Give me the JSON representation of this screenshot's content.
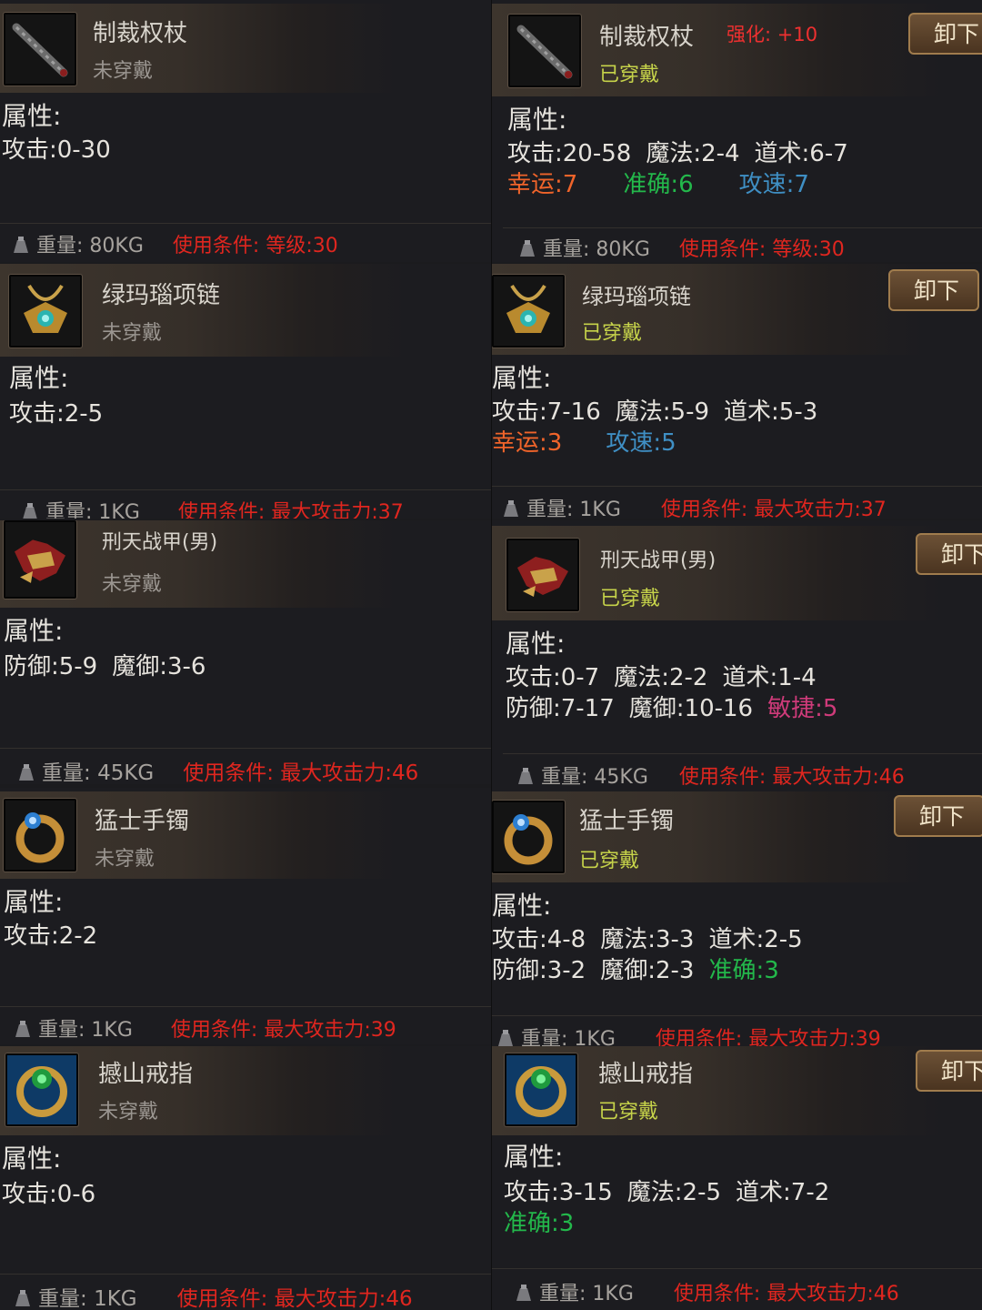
{
  "labels": {
    "attributes": "属性:",
    "weight": "重量:",
    "requirement": "使用条件:",
    "unequip": "卸下",
    "enhance": "强化: +10"
  },
  "items": [
    {
      "left": {
        "name": "制裁权杖",
        "state": "未穿戴",
        "icon": "scepter-icon",
        "lines": [
          [
            {
              "t": "攻击:0-30",
              "c": "white"
            }
          ]
        ],
        "weight": "80KG",
        "requirement": "等级:30"
      },
      "right": {
        "name": "制裁权杖",
        "state": "已穿戴",
        "icon": "scepter-icon",
        "lines": [
          [
            {
              "t": "攻击:20-58",
              "c": "white"
            },
            {
              "t": "魔法:2-4",
              "c": "white"
            },
            {
              "t": "道术:6-7",
              "c": "white"
            }
          ],
          [
            {
              "t": "幸运:7",
              "c": "orange"
            },
            {
              "t": "准确:6",
              "c": "green"
            },
            {
              "t": "攻速:7",
              "c": "blue"
            }
          ]
        ],
        "weight": "80KG",
        "requirement": "等级:30"
      }
    },
    {
      "left": {
        "name": "绿玛瑙项链",
        "state": "未穿戴",
        "icon": "necklace-icon",
        "lines": [
          [
            {
              "t": "攻击:2-5",
              "c": "white"
            }
          ]
        ],
        "weight": "1KG",
        "requirement": "最大攻击力:37"
      },
      "right": {
        "name": "绿玛瑙项链",
        "state": "已穿戴",
        "icon": "necklace-icon",
        "lines": [
          [
            {
              "t": "攻击:7-16",
              "c": "white"
            },
            {
              "t": "魔法:5-9",
              "c": "white"
            },
            {
              "t": "道术:5-3",
              "c": "white"
            }
          ],
          [
            {
              "t": "幸运:3",
              "c": "orange"
            },
            {
              "t": "攻速:5",
              "c": "blue"
            }
          ]
        ],
        "weight": "1KG",
        "requirement": "最大攻击力:37"
      }
    },
    {
      "left": {
        "name": "刑天战甲(男)",
        "state": "未穿戴",
        "icon": "armor-icon",
        "lines": [
          [
            {
              "t": "防御:5-9",
              "c": "white"
            },
            {
              "t": "魔御:3-6",
              "c": "white"
            }
          ]
        ],
        "weight": "45KG",
        "requirement": "最大攻击力:46"
      },
      "right": {
        "name": "刑天战甲(男)",
        "state": "已穿戴",
        "icon": "armor-icon",
        "lines": [
          [
            {
              "t": "攻击:0-7",
              "c": "white"
            },
            {
              "t": "魔法:2-2",
              "c": "white"
            },
            {
              "t": "道术:1-4",
              "c": "white"
            }
          ],
          [
            {
              "t": "防御:7-17",
              "c": "white"
            },
            {
              "t": "魔御:10-16",
              "c": "white"
            },
            {
              "t": "敏捷:5",
              "c": "pink"
            }
          ]
        ],
        "weight": "45KG",
        "requirement": "最大攻击力:46"
      }
    },
    {
      "left": {
        "name": "猛士手镯",
        "state": "未穿戴",
        "icon": "bracelet-icon",
        "lines": [
          [
            {
              "t": "攻击:2-2",
              "c": "white"
            }
          ]
        ],
        "weight": "1KG",
        "requirement": "最大攻击力:39"
      },
      "right": {
        "name": "猛士手镯",
        "state": "已穿戴",
        "icon": "bracelet-icon",
        "lines": [
          [
            {
              "t": "攻击:4-8",
              "c": "white"
            },
            {
              "t": "魔法:3-3",
              "c": "white"
            },
            {
              "t": "道术:2-5",
              "c": "white"
            }
          ],
          [
            {
              "t": "防御:3-2",
              "c": "white"
            },
            {
              "t": "魔御:2-3",
              "c": "white"
            },
            {
              "t": "准确:3",
              "c": "green"
            }
          ]
        ],
        "weight": "1KG",
        "requirement": "最大攻击力:39"
      }
    },
    {
      "left": {
        "name": "撼山戒指",
        "state": "未穿戴",
        "icon": "ring-icon",
        "lines": [
          [
            {
              "t": "攻击:0-6",
              "c": "white"
            }
          ]
        ],
        "weight": "1KG",
        "requirement": "最大攻击力:46"
      },
      "right": {
        "name": "撼山戒指",
        "state": "已穿戴",
        "icon": "ring-icon",
        "lines": [
          [
            {
              "t": "攻击:3-15",
              "c": "white"
            },
            {
              "t": "魔法:2-5",
              "c": "white"
            },
            {
              "t": "道术:7-2",
              "c": "white"
            }
          ],
          [
            {
              "t": "准确:3",
              "c": "green"
            }
          ]
        ],
        "weight": "1KG",
        "requirement": "最大攻击力:46"
      }
    }
  ]
}
